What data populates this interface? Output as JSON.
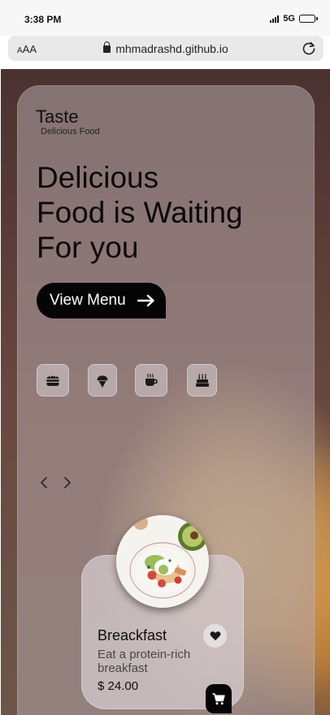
{
  "status_bar": {
    "time": "3:38 PM",
    "network": "5G",
    "icons": [
      "signal-icon",
      "battery-icon"
    ]
  },
  "browser": {
    "text_size_label": "AA",
    "url": "mhmadrashd.github.io",
    "icons": [
      "lock-icon",
      "reload-icon"
    ]
  },
  "brand": {
    "name": "Taste",
    "tagline": "Delicious Food"
  },
  "hero": {
    "line1": "Delicious",
    "line2": "Food is Waiting",
    "line3": "For you"
  },
  "cta": {
    "label": "View Menu",
    "icon": "arrow-right-icon"
  },
  "categories": [
    {
      "icon": "burger-icon"
    },
    {
      "icon": "ice-cream-icon"
    },
    {
      "icon": "coffee-icon"
    },
    {
      "icon": "cake-icon"
    }
  ],
  "carousel": {
    "prev_icon": "chevron-left-icon",
    "next_icon": "chevron-right-icon"
  },
  "product": {
    "title": "Breackfast",
    "description": "Eat a protein-rich breakfast",
    "price": "$ 24.00",
    "icons": [
      "heart-icon",
      "cart-icon"
    ]
  },
  "colors": {
    "accent": "#050505",
    "panel": "#b4a5aa",
    "background": "#5a3b36",
    "glow": "#d2802a"
  }
}
